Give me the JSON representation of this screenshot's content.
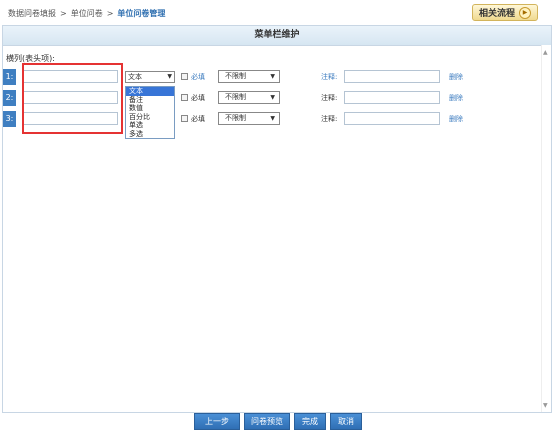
{
  "breadcrumb": {
    "items": [
      "数据问卷填报",
      "单位问卷"
    ],
    "current": "单位问卷管理",
    "separator": ">"
  },
  "related_button": {
    "label": "相关流程",
    "icon": "arrow-right-circle-icon"
  },
  "panel": {
    "title": "菜单栏维护"
  },
  "section": {
    "label": "横列(表头项):"
  },
  "rows": [
    {
      "num": "1:",
      "name_value": "",
      "type": "文本",
      "required_label": "必填",
      "limit": "不限制",
      "note_label": "注释:",
      "note_value": "",
      "delete_label": "删除"
    },
    {
      "num": "2:",
      "name_value": "",
      "type": "文本",
      "required_label": "必填",
      "limit": "不限制",
      "note_label": "注释:",
      "note_value": "",
      "delete_label": "删除"
    },
    {
      "num": "3:",
      "name_value": "",
      "type": "文本",
      "required_label": "必填",
      "limit": "不限制",
      "note_label": "注释:",
      "note_value": "",
      "delete_label": "删除"
    }
  ],
  "type_dropdown": {
    "options": [
      "文本",
      "备注",
      "数值",
      "百分比",
      "单选",
      "多选"
    ],
    "selected_index": 0
  },
  "footer": {
    "prev": "上一步",
    "preview": "问卷预览",
    "finish": "完成",
    "cancel": "取消"
  },
  "colors": {
    "accent": "#3f7fc1",
    "highlight": "#e53333",
    "link": "#3b7bbf"
  }
}
